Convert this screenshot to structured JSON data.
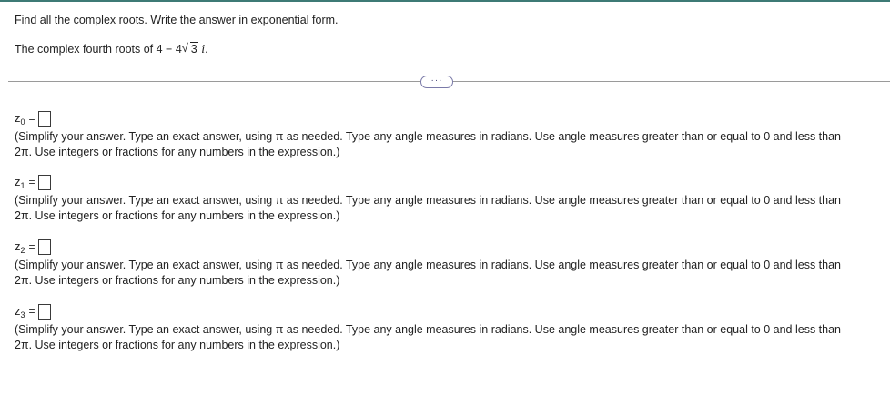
{
  "question": {
    "instruction": "Find all the complex roots. Write the answer in exponential form.",
    "prompt_prefix": "The complex fourth roots of 4 − 4",
    "radical_symbol": "√",
    "radicand": "3",
    "imag_unit": " i",
    "period": "."
  },
  "more_button": {
    "label": "···"
  },
  "answers": [
    {
      "var": "z",
      "sub": "0",
      "equals": "=",
      "value": "",
      "hint_line1": "(Simplify your answer. Type an exact answer, using π as needed. Type any angle measures in radians. Use angle measures greater than or equal to 0 and less than",
      "hint_line2": "2π. Use integers or fractions for any numbers in the expression.)"
    },
    {
      "var": "z",
      "sub": "1",
      "equals": "=",
      "value": "",
      "hint_line1": "(Simplify your answer. Type an exact answer, using π as needed. Type any angle measures in radians. Use angle measures greater than or equal to 0 and less than",
      "hint_line2": "2π. Use integers or fractions for any numbers in the expression.)"
    },
    {
      "var": "z",
      "sub": "2",
      "equals": "=",
      "value": "",
      "hint_line1": "(Simplify your answer. Type an exact answer, using π as needed. Type any angle measures in radians. Use angle measures greater than or equal to 0 and less than",
      "hint_line2": "2π. Use integers or fractions for any numbers in the expression.)"
    },
    {
      "var": "z",
      "sub": "3",
      "equals": "=",
      "value": "",
      "hint_line1": "(Simplify your answer. Type an exact answer, using π as needed. Type any angle measures in radians. Use angle measures greater than or equal to 0 and less than",
      "hint_line2": "2π. Use integers or fractions for any numbers in the expression.)"
    }
  ],
  "colors": {
    "top_rule": "#3d7a75",
    "divider": "#9a9a9a",
    "more_button_border": "#7a7aa8",
    "text": "#222222"
  }
}
